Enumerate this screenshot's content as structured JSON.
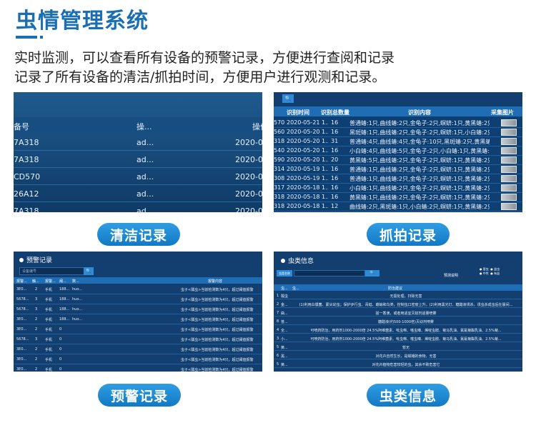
{
  "header": {
    "title": "虫情管理系统",
    "desc_line1": "实时监测，可以查看所有设备的预警记录，方便进行查阅和记录",
    "desc_line2": "记录了所有设备的清洁/抓拍时间，方便用户进行观测和记录。"
  },
  "colors": {
    "accent": "#1a6fb3",
    "pill": "#1f86d0"
  },
  "pills": {
    "clean": "清洁记录",
    "capture": "抓拍记录",
    "warning": "预警记录",
    "insect": "虫类信息"
  },
  "clean_panel": {
    "headers": [
      "备号",
      "操...",
      "操作"
    ],
    "rows": [
      [
        "7A318",
        "ad...",
        "2020-05-"
      ],
      [
        "7A318",
        "ad...",
        "2020-05-"
      ],
      [
        "CD570",
        "ad...",
        "2020-05-"
      ],
      [
        "26A12",
        "ad...",
        "2020-05-"
      ],
      [
        "7A318",
        "ad...",
        "2020-05-"
      ]
    ]
  },
  "capture_panel": {
    "search_icon": "search-icon",
    "headers": [
      "识别时间",
      "识别总数量",
      "识别内容",
      "采集图片"
    ],
    "rows": [
      [
        "570",
        "2020-05-21 1...",
        "16",
        "普通蝽:1只,曲线蝽:2只,金龟子:2只,螟蛴:1只,黄黑蝽:2只,瓢虫:4只,..."
      ],
      [
        "560",
        "2020-05-20 1...",
        "16",
        "黑斑蝽:1只,曲线蝽:2只,金龟子:2只,螟蛴:1只,小白蝽:2只,瓢虫:4只,..."
      ],
      [
        "318",
        "2020-05-20 1...",
        "31",
        "普通蝽:4只,曲线蝽:4只,金龟子:10只,黑斑蝽:2只,黄黑蝽:2只,瓢虫:..."
      ],
      [
        "540",
        "2020-05-20 1...",
        "16",
        "小白蝽:4只,曲线蝽:5只,金龟子:2只,小白蝽:1只,黄黑蝽:4只,瓢虫:1只,..."
      ],
      [
        "590",
        "2020-05-20 1...",
        "20",
        "黄黑蝽:5只,曲线蝽:2只,金龟子:2只,螟蛴:1只,黄黑蝽:2只,瓢虫:4只,..."
      ],
      [
        "314",
        "2020-05-19 1...",
        "16",
        "普通蝽:1只,曲线蝽:2只,金龟子:2只,螟蛴:1只,黄黑蝽:2只,瓢虫:4只,..."
      ],
      [
        "308",
        "2020-05-19 1...",
        "16",
        "普通蝽:1只,曲线蝽:2只,金龟子:2只,螟蛴:1只,黄黑蝽:2只,瓢虫:4只,..."
      ],
      [
        "317",
        "2020-05-18 1...",
        "16",
        "小白蝽:1只,曲线蝽:2只,金龟子:2只,螟蛴:1只,黄黑蝽:2只,瓢虫:4只,..."
      ],
      [
        "318",
        "2020-05-18 1...",
        "16",
        "黄黑蝽:1只,曲线蝽:2只,金龟子:2只,螟蛴:1只,黄黑蝽:2只,瓢虫:4只,..."
      ],
      [
        "318",
        "2020-05-18 1...",
        "12",
        "曲线蝽:2只,黑斑蝽:1只,小白蝽:2只,螟蛴:1只,黄黑蝽:2只,瓢虫:4只,..."
      ]
    ]
  },
  "warning_panel": {
    "title": "预警记录",
    "search_placeholder": "设备编号",
    "search_icon": "search-icon",
    "headers": [
      "报警...",
      "触...",
      "报警...",
      "阈...",
      "数...",
      "报警内容"
    ],
    "rows": [
      [
        "3E0...",
        "2",
        "手机",
        "188...",
        "huo...",
        "虫子<瓢虫>当前检测数为4只，超过阈值报警"
      ],
      [
        "5678...",
        "3",
        "手机",
        "188...",
        "huo...",
        "虫子<瓢虫>当前检测数为4只，超过阈值报警"
      ],
      [
        "5678...",
        "3",
        "手机",
        "188...",
        "huo...",
        "虫子<瓢虫>当前检测数为4只，超过阈值报警"
      ],
      [
        "3E0...",
        "2",
        "手机",
        "188...",
        "huo...",
        "虫子<瓢虫>当前检测数为4只，超过阈值报警"
      ],
      [
        "3E0...",
        "2",
        "手机",
        "0",
        "",
        "虫子<瓢虫>当前检测数为4只，超过阈值报警"
      ],
      [
        "5678...",
        "3",
        "手机",
        "0",
        "",
        "虫子<瓢虫>当前检测数为4只，超过阈值报警"
      ],
      [
        "3E0...",
        "2",
        "手机",
        "0",
        "",
        "虫子<瓢虫>当前检测数为4只，超过阈值报警"
      ],
      [
        "3E0...",
        "2",
        "手机",
        "0",
        "",
        "虫子<瓢虫>当前检测数为4只，超过阈值报警"
      ],
      [
        "3E0...",
        "2",
        "手机",
        "0",
        "",
        "虫子<瓢虫>当前检测数为4只，超过阈值报警"
      ]
    ]
  },
  "insect_panel": {
    "title": "虫类信息",
    "search_icon": "search-icon",
    "left_btn": "虫类名称",
    "search_btn": "查询",
    "legend_label": "预测说明",
    "legend_text": "● 害虫  ● 益虫\n● 中性  ● 有益",
    "headers": [
      "虫...",
      "虫...",
      "防治建议"
    ],
    "rows": [
      [
        "1",
        "瓢虫",
        "无需处理，扫除无害"
      ],
      [
        "2",
        "金...",
        "(1)利用白僵菌、蒙尖幼虫；保护步行虫、青蛙、蟾蜍和鸟类，控制虫口密度上升。(2)利用黑光灯、糖醋液诱杀，诱虫杀成虫后在晨间..."
      ],
      [
        "7",
        "曲...",
        "拔一香滴，或者用适宜灭蚊剂适量喷雾"
      ],
      [
        "8",
        "普...",
        "糖醋液(约500-1000倍)灭幼剂喷雾"
      ],
      [
        "4",
        "全...",
        "可喷药防治，用药剂1000-2000倍 24.5%阿维菌素、吡虫啉、噻虫嗪、烯啶虫胺、菊马乳油、氯氰菊酯乳油、2.5%菊..."
      ],
      [
        "3",
        "小...",
        "可喷药防治，用药剂1000-2000倍 24.5%阿维菌素、吡虫啉、噻虫嗪、烯啶虫胺、菊马乳油、氯氰菊酯乳油、2.5%菊..."
      ],
      [
        "5",
        "黄...",
        "暂无"
      ],
      [
        "6",
        "黑...",
        "对花卉自然生长，是螟蛾的食物，无害"
      ],
      [
        "5",
        "黄...",
        "对花卉植物危害较轻的虫，其余不致危害它"
      ]
    ]
  }
}
